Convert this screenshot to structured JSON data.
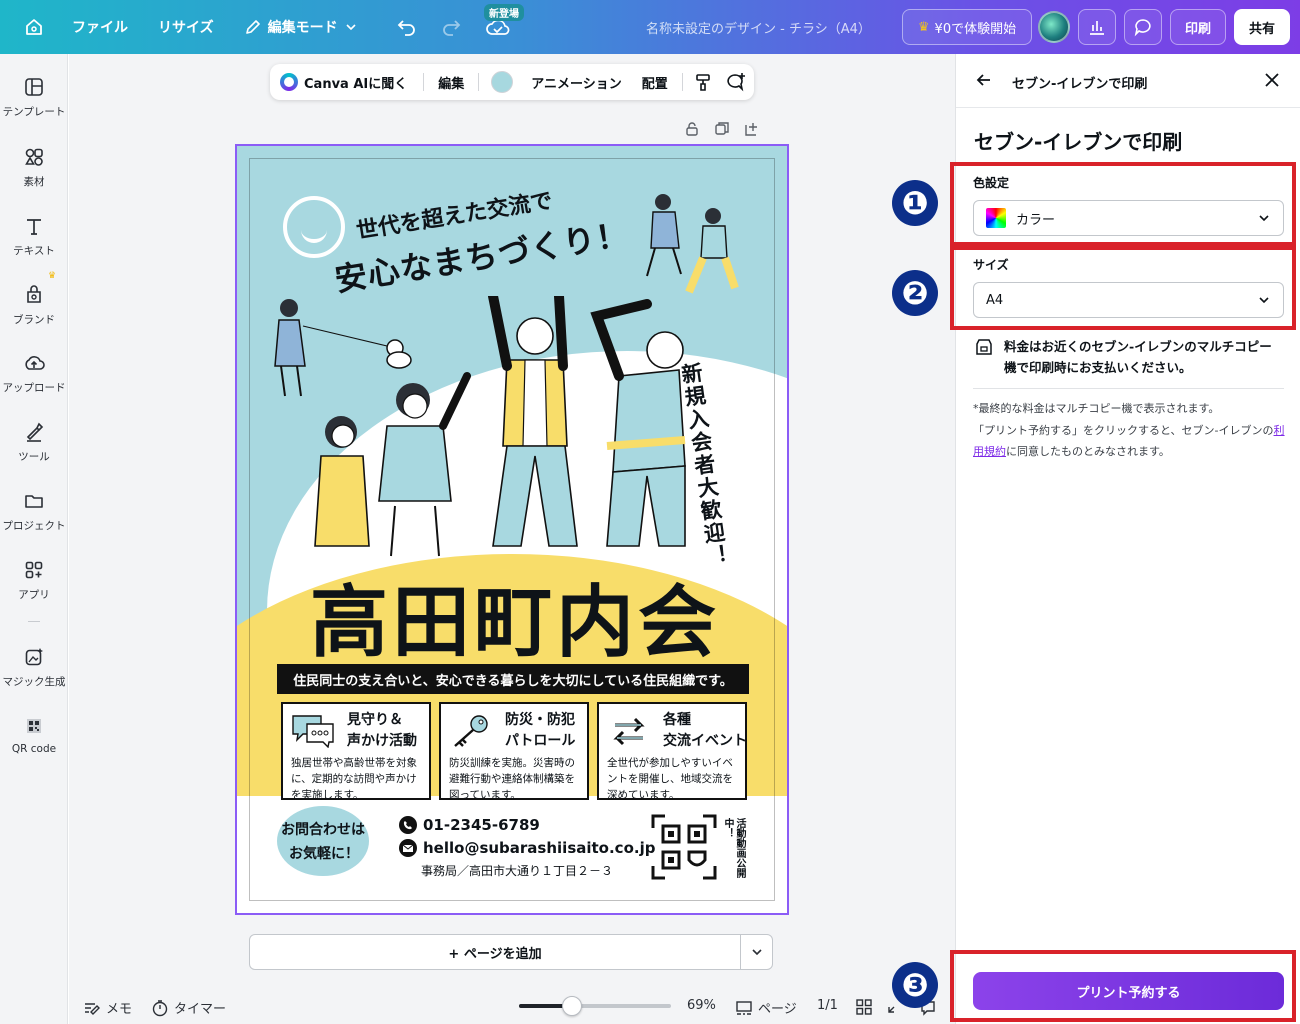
{
  "header": {
    "menu_file": "ファイル",
    "menu_resize": "リサイズ",
    "edit_mode": "編集モード",
    "new_badge": "新登場",
    "design_title": "名称未設定のデザイン - チラシ（A4）",
    "trial_label": "¥0で体験開始",
    "print_label": "印刷",
    "share_label": "共有"
  },
  "sidebar": {
    "items": [
      {
        "label": "テンプレート",
        "icon": "template-icon"
      },
      {
        "label": "素材",
        "icon": "elements-icon"
      },
      {
        "label": "テキスト",
        "icon": "text-icon"
      },
      {
        "label": "ブランド",
        "icon": "brand-icon"
      },
      {
        "label": "アップロード",
        "icon": "upload-icon"
      },
      {
        "label": "ツール",
        "icon": "tools-icon"
      },
      {
        "label": "プロジェクト",
        "icon": "folder-icon"
      },
      {
        "label": "アプリ",
        "icon": "apps-icon"
      },
      {
        "label": "マジック生成",
        "icon": "magic-icon"
      },
      {
        "label": "QR code",
        "icon": "qr-icon"
      }
    ]
  },
  "context_toolbar": {
    "ask_ai": "Canva AIに聞く",
    "edit": "編集",
    "animation": "アニメーション",
    "position": "配置",
    "fill_color": "#a7d8df"
  },
  "flyer": {
    "heading_line1": "世代を超えた交流で",
    "heading_line2": "安心なまちづくり！",
    "vertical_text": "新規入会者大歓迎！",
    "title": "高田町内会",
    "banner": "住民同士の支え合いと、安心できる暮らしを大切にしている住民組織です。",
    "features": [
      {
        "title1": "見守り＆",
        "title2": "声かけ活動",
        "desc": "独居世帯や高齢世帯を対象に、定期的な訪問や声かけを実施します。"
      },
      {
        "title1": "防災・防犯",
        "title2": "パトロール",
        "desc": "防災訓練を実施。災害時の避難行動や連絡体制構築を図っています。"
      },
      {
        "title1": "各種",
        "title2": "交流イベント",
        "desc": "全世代が参加しやすいイベントを開催し、地域交流を深めています。"
      }
    ],
    "contact_title1": "お問合わせは",
    "contact_title2": "お気軽に！",
    "phone": "01-2345-6789",
    "email": "hello@subarashiisaito.co.jp",
    "address": "事務局／高田市大通り１丁目２－３",
    "qr_note": "活動動画公開中！",
    "colors": {
      "sky": "#a8d8e0",
      "yellow": "#f8dd6a"
    }
  },
  "canvas": {
    "add_page": "+ ページを追加"
  },
  "bottom_bar": {
    "notes": "メモ",
    "timer": "タイマー",
    "zoom": "69%",
    "zoom_fraction": 0.35,
    "pages_label": "ページ",
    "page_count": "1/1"
  },
  "panel": {
    "header_title": "セブン-イレブンで印刷",
    "title": "セブン-イレブンで印刷",
    "color_label": "色設定",
    "color_value": "カラー",
    "size_label": "サイズ",
    "size_value": "A4",
    "fee_info": "料金はお近くのセブン-イレブンのマルチコピー機で印刷時にお支払いください。",
    "note1": "*最終的な料金はマルチコピー機で表示されます。",
    "note2_pre": "「プリント予約する」をクリックすると、セブン-イレブンの",
    "note2_link": "利用規約",
    "note2_post": "に同意したものとみなされます。",
    "reserve_button": "プリント予約する"
  },
  "annotations": {
    "n1": "❶",
    "n2": "❷",
    "n3": "❸",
    "box_color": "#d9222a"
  }
}
